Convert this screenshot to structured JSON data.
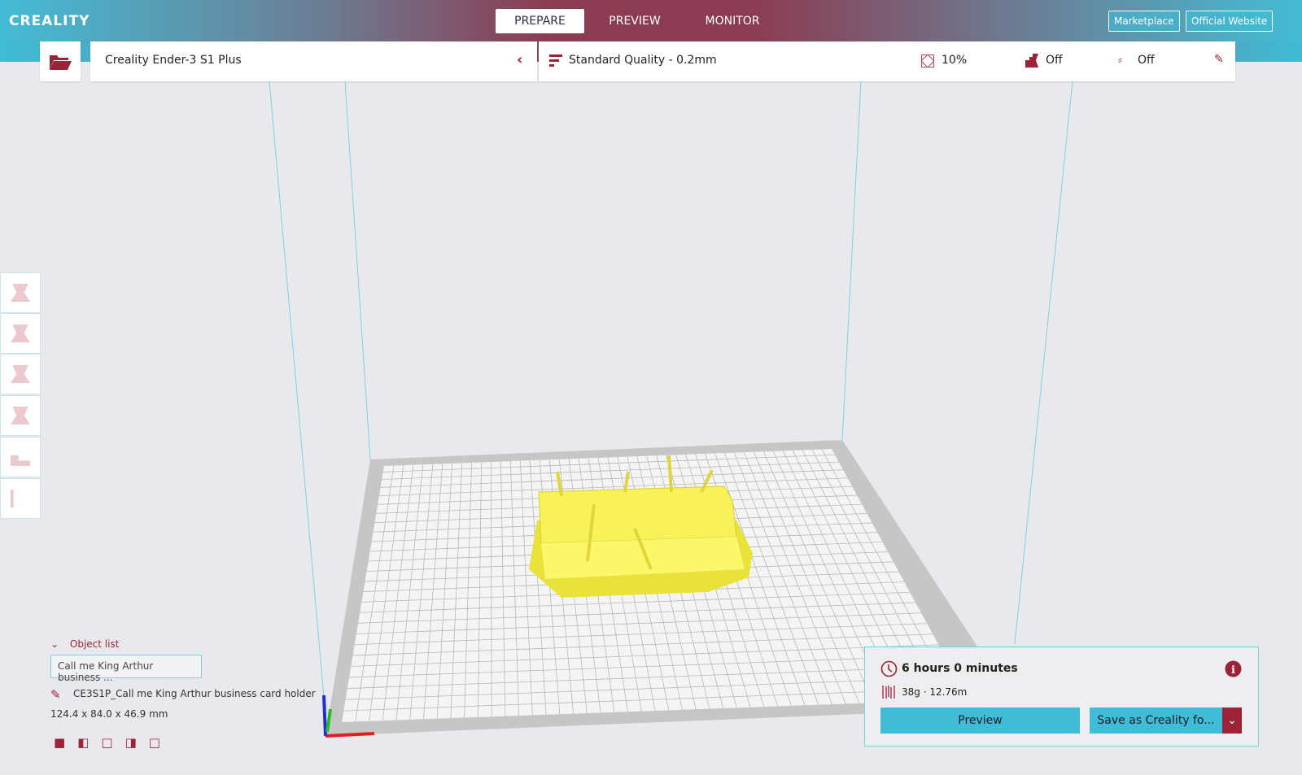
{
  "header": {
    "logo": "CREALITY",
    "tabs": [
      {
        "label": "PREPARE",
        "active": true
      },
      {
        "label": "PREVIEW"
      },
      {
        "label": "MONITOR"
      }
    ],
    "marketplace": "Marketplace",
    "official_website": "Official Website"
  },
  "printer": {
    "name": "Creality Ender-3 S1 Plus"
  },
  "settings": {
    "profile": "Standard Quality - 0.2mm",
    "infill": "10%",
    "support": "Off",
    "adhesion": "Off"
  },
  "object_list": {
    "label": "Object list",
    "selected": "Call me King Arthur business ...",
    "filename": "CE3S1P_Call me King Arthur business card holder",
    "dimensions": "124.4 x 84.0 x 46.9 mm"
  },
  "print_info": {
    "time": "6 hours 0 minutes",
    "material": "38g · 12.76m",
    "preview_label": "Preview",
    "save_label": "Save as Creality fo..."
  },
  "colors": {
    "accent": "#41bcd6",
    "brand": "#9b2237",
    "model": "#f5f04a"
  }
}
